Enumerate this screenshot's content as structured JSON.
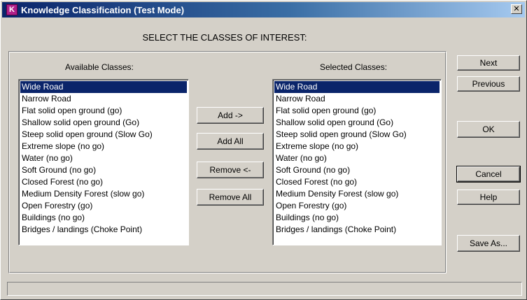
{
  "window": {
    "title": "Knowledge Classification (Test Mode)",
    "close_glyph": "✕"
  },
  "instruction": "SELECT THE CLASSES OF INTEREST:",
  "available": {
    "caption": "Available Classes:",
    "items": [
      "Wide Road",
      "Narrow Road",
      "Flat solid open ground (go)",
      "Shallow solid open ground (Go)",
      "Steep solid open ground (Slow Go)",
      "Extreme slope (no go)",
      "Water (no go)",
      "Soft Ground (no go)",
      "Closed Forest (no go)",
      "Medium Density Forest (slow go)",
      "Open Forestry (go)",
      "Buildings (no go)",
      "Bridges / landings (Choke Point)"
    ],
    "selected_index": 0
  },
  "selected": {
    "caption": "Selected Classes:",
    "items": [
      "Wide Road",
      "Narrow Road",
      "Flat solid open ground (go)",
      "Shallow solid open ground (Go)",
      "Steep solid open ground (Slow Go)",
      "Extreme slope (no go)",
      "Water (no go)",
      "Soft Ground (no go)",
      "Closed Forest (no go)",
      "Medium Density Forest (slow go)",
      "Open Forestry (go)",
      "Buildings (no go)",
      "Bridges / landings (Choke Point)"
    ],
    "selected_index": 0
  },
  "transfer_buttons": {
    "add": "Add ->",
    "add_all": "Add All",
    "remove": "Remove <-",
    "remove_all": "Remove All"
  },
  "side_buttons": {
    "next": "Next",
    "previous": "Previous",
    "ok": "OK",
    "cancel": "Cancel",
    "help": "Help",
    "save_as": "Save As..."
  },
  "status": ""
}
